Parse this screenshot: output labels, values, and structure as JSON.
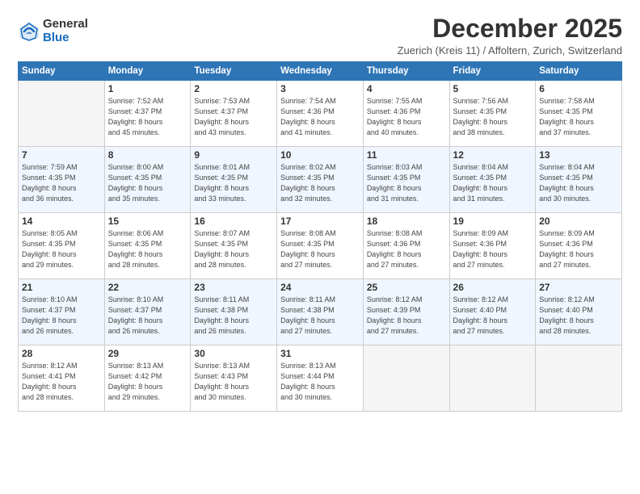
{
  "logo": {
    "general": "General",
    "blue": "Blue"
  },
  "header": {
    "month": "December 2025",
    "subtitle": "Zuerich (Kreis 11) / Affoltern, Zurich, Switzerland"
  },
  "days": [
    "Sunday",
    "Monday",
    "Tuesday",
    "Wednesday",
    "Thursday",
    "Friday",
    "Saturday"
  ],
  "weeks": [
    [
      {
        "num": "",
        "info": ""
      },
      {
        "num": "1",
        "info": "Sunrise: 7:52 AM\nSunset: 4:37 PM\nDaylight: 8 hours\nand 45 minutes."
      },
      {
        "num": "2",
        "info": "Sunrise: 7:53 AM\nSunset: 4:37 PM\nDaylight: 8 hours\nand 43 minutes."
      },
      {
        "num": "3",
        "info": "Sunrise: 7:54 AM\nSunset: 4:36 PM\nDaylight: 8 hours\nand 41 minutes."
      },
      {
        "num": "4",
        "info": "Sunrise: 7:55 AM\nSunset: 4:36 PM\nDaylight: 8 hours\nand 40 minutes."
      },
      {
        "num": "5",
        "info": "Sunrise: 7:56 AM\nSunset: 4:35 PM\nDaylight: 8 hours\nand 38 minutes."
      },
      {
        "num": "6",
        "info": "Sunrise: 7:58 AM\nSunset: 4:35 PM\nDaylight: 8 hours\nand 37 minutes."
      }
    ],
    [
      {
        "num": "7",
        "info": "Sunrise: 7:59 AM\nSunset: 4:35 PM\nDaylight: 8 hours\nand 36 minutes."
      },
      {
        "num": "8",
        "info": "Sunrise: 8:00 AM\nSunset: 4:35 PM\nDaylight: 8 hours\nand 35 minutes."
      },
      {
        "num": "9",
        "info": "Sunrise: 8:01 AM\nSunset: 4:35 PM\nDaylight: 8 hours\nand 33 minutes."
      },
      {
        "num": "10",
        "info": "Sunrise: 8:02 AM\nSunset: 4:35 PM\nDaylight: 8 hours\nand 32 minutes."
      },
      {
        "num": "11",
        "info": "Sunrise: 8:03 AM\nSunset: 4:35 PM\nDaylight: 8 hours\nand 31 minutes."
      },
      {
        "num": "12",
        "info": "Sunrise: 8:04 AM\nSunset: 4:35 PM\nDaylight: 8 hours\nand 31 minutes."
      },
      {
        "num": "13",
        "info": "Sunrise: 8:04 AM\nSunset: 4:35 PM\nDaylight: 8 hours\nand 30 minutes."
      }
    ],
    [
      {
        "num": "14",
        "info": "Sunrise: 8:05 AM\nSunset: 4:35 PM\nDaylight: 8 hours\nand 29 minutes."
      },
      {
        "num": "15",
        "info": "Sunrise: 8:06 AM\nSunset: 4:35 PM\nDaylight: 8 hours\nand 28 minutes."
      },
      {
        "num": "16",
        "info": "Sunrise: 8:07 AM\nSunset: 4:35 PM\nDaylight: 8 hours\nand 28 minutes."
      },
      {
        "num": "17",
        "info": "Sunrise: 8:08 AM\nSunset: 4:35 PM\nDaylight: 8 hours\nand 27 minutes."
      },
      {
        "num": "18",
        "info": "Sunrise: 8:08 AM\nSunset: 4:36 PM\nDaylight: 8 hours\nand 27 minutes."
      },
      {
        "num": "19",
        "info": "Sunrise: 8:09 AM\nSunset: 4:36 PM\nDaylight: 8 hours\nand 27 minutes."
      },
      {
        "num": "20",
        "info": "Sunrise: 8:09 AM\nSunset: 4:36 PM\nDaylight: 8 hours\nand 27 minutes."
      }
    ],
    [
      {
        "num": "21",
        "info": "Sunrise: 8:10 AM\nSunset: 4:37 PM\nDaylight: 8 hours\nand 26 minutes."
      },
      {
        "num": "22",
        "info": "Sunrise: 8:10 AM\nSunset: 4:37 PM\nDaylight: 8 hours\nand 26 minutes."
      },
      {
        "num": "23",
        "info": "Sunrise: 8:11 AM\nSunset: 4:38 PM\nDaylight: 8 hours\nand 26 minutes."
      },
      {
        "num": "24",
        "info": "Sunrise: 8:11 AM\nSunset: 4:38 PM\nDaylight: 8 hours\nand 27 minutes."
      },
      {
        "num": "25",
        "info": "Sunrise: 8:12 AM\nSunset: 4:39 PM\nDaylight: 8 hours\nand 27 minutes."
      },
      {
        "num": "26",
        "info": "Sunrise: 8:12 AM\nSunset: 4:40 PM\nDaylight: 8 hours\nand 27 minutes."
      },
      {
        "num": "27",
        "info": "Sunrise: 8:12 AM\nSunset: 4:40 PM\nDaylight: 8 hours\nand 28 minutes."
      }
    ],
    [
      {
        "num": "28",
        "info": "Sunrise: 8:12 AM\nSunset: 4:41 PM\nDaylight: 8 hours\nand 28 minutes."
      },
      {
        "num": "29",
        "info": "Sunrise: 8:13 AM\nSunset: 4:42 PM\nDaylight: 8 hours\nand 29 minutes."
      },
      {
        "num": "30",
        "info": "Sunrise: 8:13 AM\nSunset: 4:43 PM\nDaylight: 8 hours\nand 30 minutes."
      },
      {
        "num": "31",
        "info": "Sunrise: 8:13 AM\nSunset: 4:44 PM\nDaylight: 8 hours\nand 30 minutes."
      },
      {
        "num": "",
        "info": ""
      },
      {
        "num": "",
        "info": ""
      },
      {
        "num": "",
        "info": ""
      }
    ]
  ]
}
